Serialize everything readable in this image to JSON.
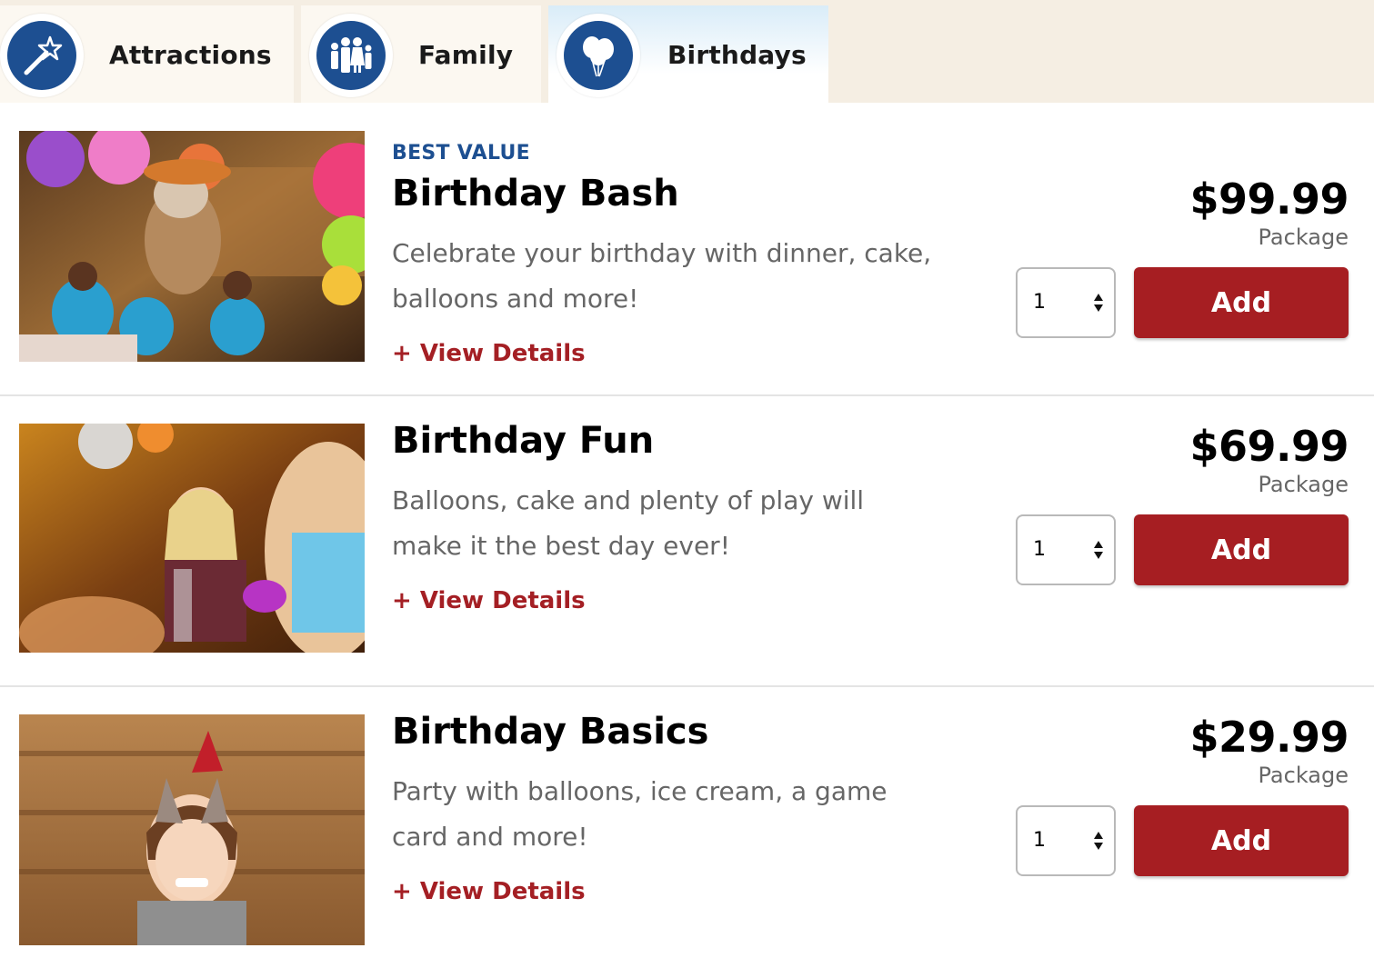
{
  "tabs": [
    {
      "label": "Attractions",
      "icon": "magic-wand-icon",
      "active": false
    },
    {
      "label": "Family",
      "icon": "family-icon",
      "active": false
    },
    {
      "label": "Birthdays",
      "icon": "balloons-icon",
      "active": true
    }
  ],
  "products": [
    {
      "badge": "BEST VALUE",
      "title": "Birthday Bash",
      "description": "Celebrate your birthday with dinner, cake, balloons and more!",
      "details_link": "+ View Details",
      "price": "$99.99",
      "price_unit": "Package",
      "quantity": "1",
      "add_label": "Add"
    },
    {
      "badge": "",
      "title": "Birthday Fun",
      "description": "Balloons, cake and plenty of play will make it the best day ever!",
      "details_link": "+ View Details",
      "price": "$69.99",
      "price_unit": "Package",
      "quantity": "1",
      "add_label": "Add"
    },
    {
      "badge": "",
      "title": "Birthday Basics",
      "description": "Party with balloons, ice cream, a game card and more!",
      "details_link": "+ View Details",
      "price": "$29.99",
      "price_unit": "Package",
      "quantity": "1",
      "add_label": "Add"
    }
  ],
  "colors": {
    "brand_blue": "#1d4f91",
    "action_red": "#a61e22",
    "link_red": "#a41f24",
    "tab_bg": "#f5eee3"
  }
}
